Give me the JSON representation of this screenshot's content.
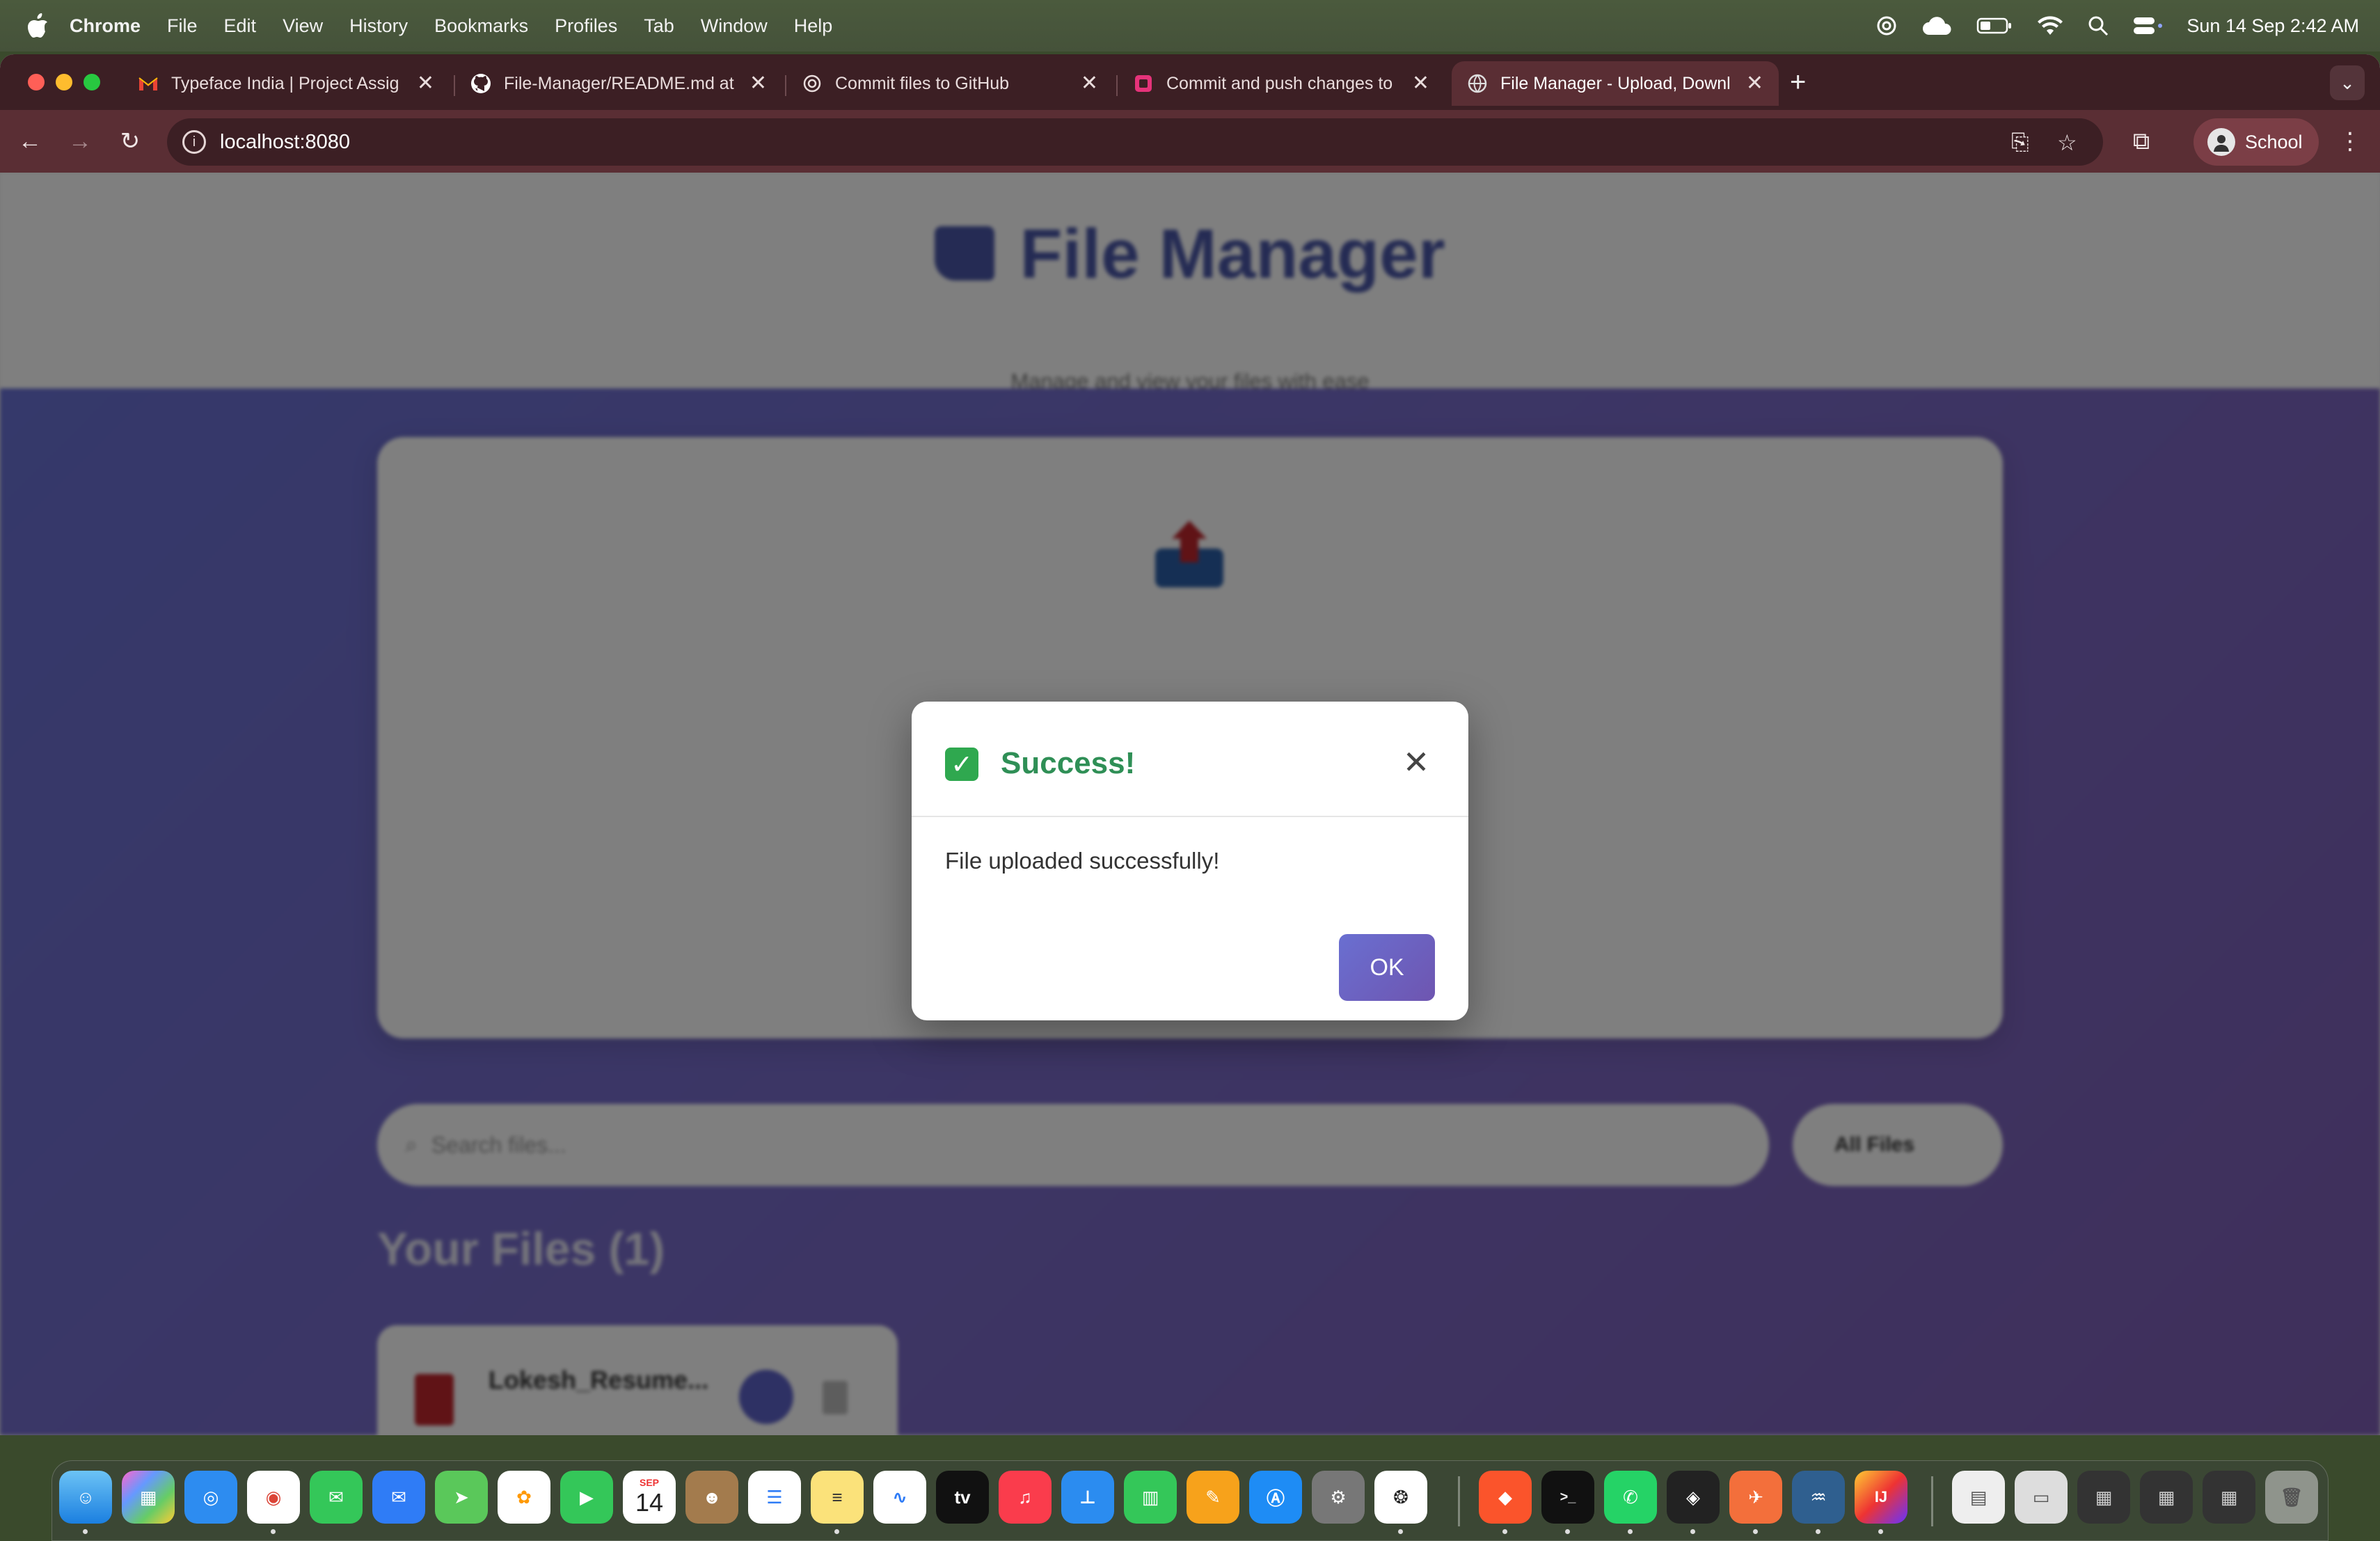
{
  "menubar": {
    "app": "Chrome",
    "items": [
      "File",
      "Edit",
      "View",
      "History",
      "Bookmarks",
      "Profiles",
      "Tab",
      "Window",
      "Help"
    ],
    "clock": "Sun 14 Sep  2:42 AM"
  },
  "tabs": [
    {
      "title": "Typeface India | Project Assig",
      "icon": "gmail-icon",
      "active": false
    },
    {
      "title": "File-Manager/README.md at",
      "icon": "github-icon",
      "active": false
    },
    {
      "title": "Commit files to GitHub",
      "icon": "chatgpt-icon",
      "active": false
    },
    {
      "title": "Commit and push changes to",
      "icon": "app-icon",
      "active": false
    },
    {
      "title": "File Manager - Upload, Downl",
      "icon": "globe-icon",
      "active": true
    }
  ],
  "toolbar": {
    "url": "localhost:8080",
    "profile_label": "School"
  },
  "page": {
    "title": "File Manager",
    "subtitle": "Manage and view your files with ease",
    "search_placeholder": "Search files...",
    "filter_value": "All Files",
    "files_heading": "Your Files (1)",
    "file_name": "Lokesh_Resume..."
  },
  "modal": {
    "title": "Success!",
    "message": "File uploaded successfully!",
    "ok_label": "OK",
    "close_glyph": "✕"
  },
  "dock": {
    "calendar_month": "SEP",
    "calendar_day": "14",
    "tv_label": "tv"
  }
}
